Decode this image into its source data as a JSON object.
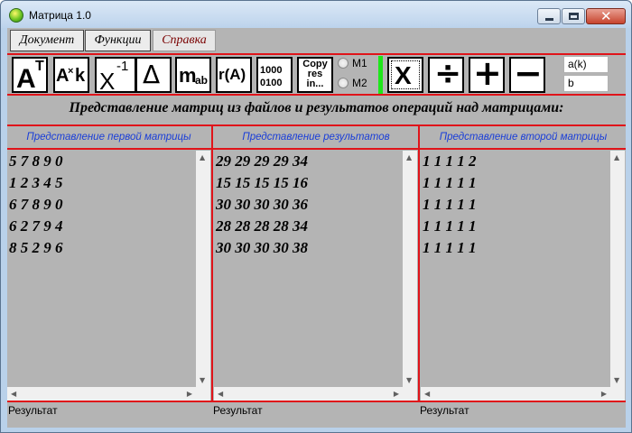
{
  "window": {
    "title": "Матрица 1.0"
  },
  "menu": {
    "items": [
      "Документ",
      "Функции",
      "Справка"
    ]
  },
  "toolbar": {
    "transpose": {
      "base": "A",
      "sup": "T"
    },
    "scalar": {
      "a": "A",
      "op": "×",
      "k": "k"
    },
    "inverse": {
      "base": "X",
      "sup": "-1"
    },
    "determinant": {
      "symbol": "Δ"
    },
    "minor": {
      "base": "m",
      "sub": "ab"
    },
    "rank": {
      "label": "r(A)"
    },
    "binary": {
      "line1": "1000",
      "line2": "0100"
    },
    "copy": {
      "line1": "Copy",
      "line2": "res",
      "line3": "in..."
    },
    "radio_m1": "M1",
    "radio_m2": "M2",
    "multiply": "X",
    "divide": "÷",
    "add": "+",
    "subtract": "−",
    "field_ak": "a(k)",
    "field_b": "b"
  },
  "heading": "Представление матриц из файлов и результатов операций над матрицами:",
  "panels": {
    "first": {
      "header": "Представление первой матрицы",
      "content": "5 7 8 9 0\n1 2 3 4 5\n6 7 8 9 0\n6 2 7 9 4\n8 5 2 9 6",
      "result": "Результат"
    },
    "result": {
      "header": "Представление результатов",
      "content": "29 29 29 29 34\n15 15 15 15 16\n30 30 30 30 36\n28 28 28 28 34\n30 30 30 30 38",
      "result": "Результат"
    },
    "second": {
      "header": "Представление второй матрицы",
      "content": "1 1 1 1 2\n1 1 1 1 1\n1 1 1 1 1\n1 1 1 1 1\n1 1 1 1 1",
      "result": "Результат"
    }
  }
}
